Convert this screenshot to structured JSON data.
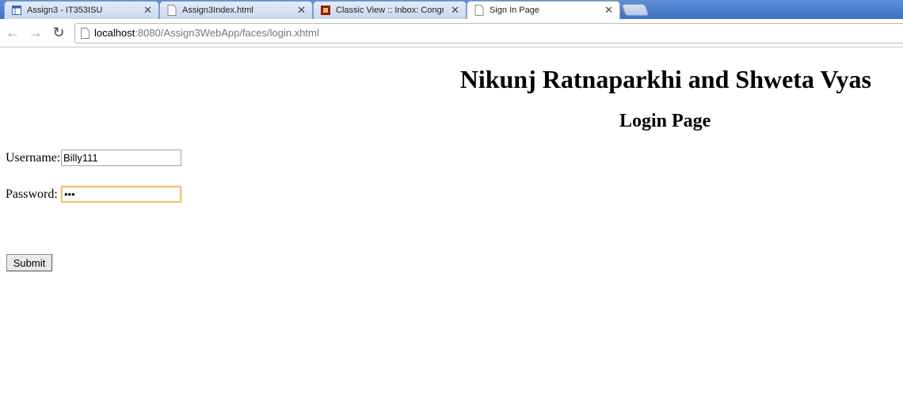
{
  "browser": {
    "tabs": [
      {
        "title": "Assign3 - IT353ISU",
        "icon": "site-icon"
      },
      {
        "title": "Assign3Index.html",
        "icon": "page-icon"
      },
      {
        "title": "Classic View :: Inbox: Congr",
        "icon": "mail-icon"
      },
      {
        "title": "Sign In Page",
        "icon": "page-icon"
      }
    ],
    "close_glyph": "✕",
    "nav": {
      "back": "←",
      "forward": "→",
      "reload": "↻"
    },
    "address": {
      "host": "localhost",
      "rest": ":8080/Assign3WebApp/faces/login.xhtml"
    }
  },
  "page": {
    "title": "Nikunj Ratnaparkhi and Shweta Vyas",
    "subtitle": "Login Page",
    "username_label": "Username:",
    "username_value": "Billy111",
    "password_label": "Password:",
    "password_value": "•••",
    "submit_label": "Submit"
  }
}
